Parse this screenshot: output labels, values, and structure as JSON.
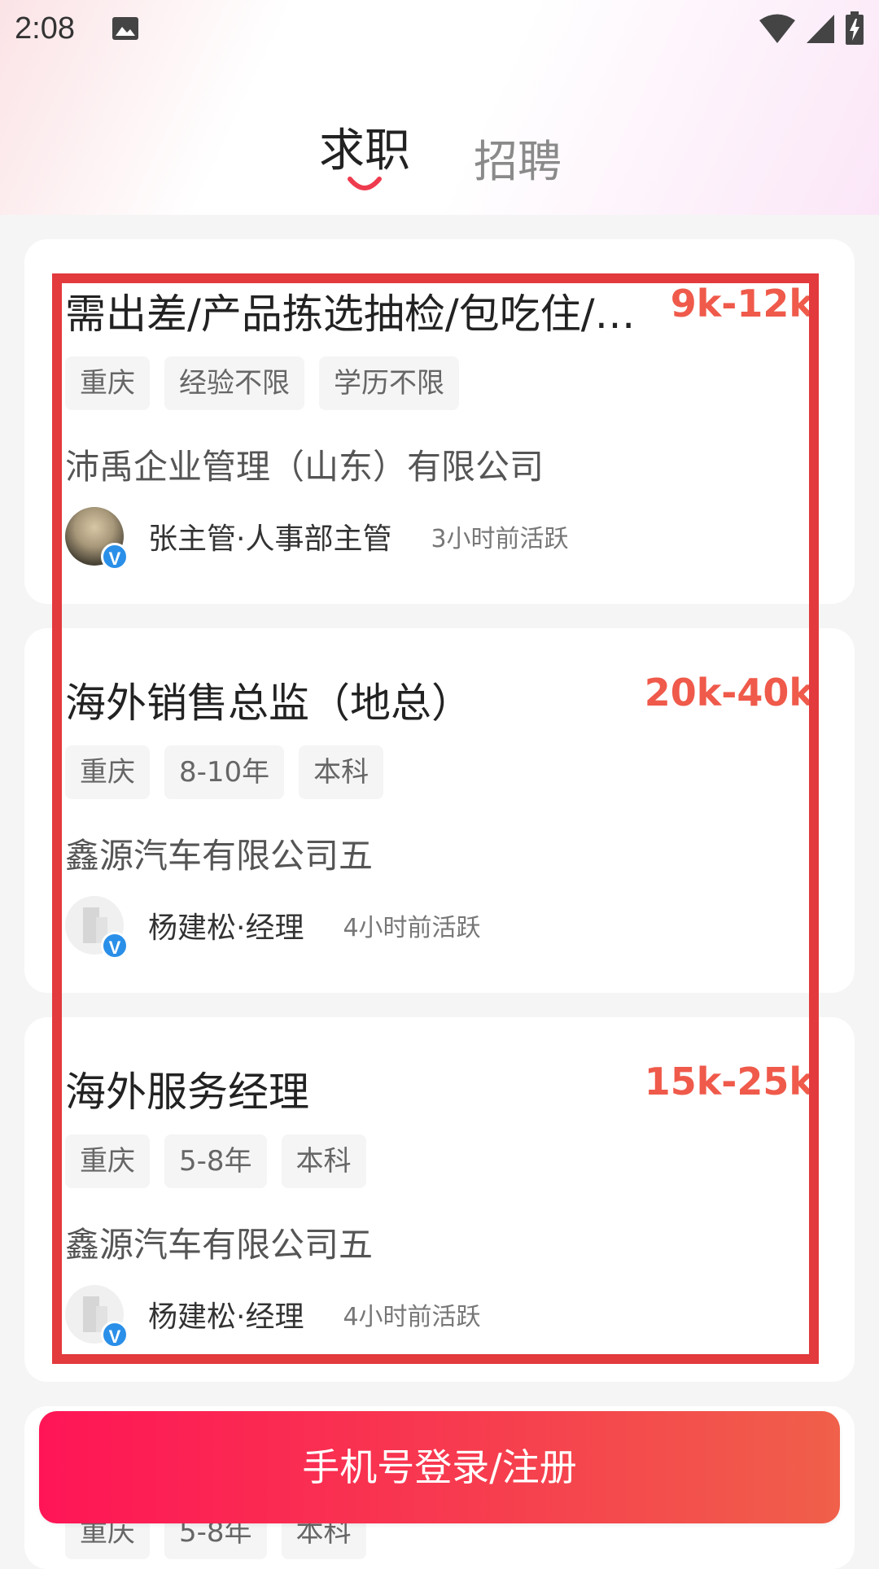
{
  "status_bar": {
    "time": "2:08",
    "icons": [
      "image-icon",
      "wifi-icon",
      "signal-icon",
      "battery-charging-icon"
    ]
  },
  "tabs": [
    {
      "label": "求职",
      "active": true
    },
    {
      "label": "招聘",
      "active": false
    }
  ],
  "jobs": [
    {
      "title": "需出差/产品拣选抽检/包吃住/…",
      "salary": "9k-12k",
      "tags": [
        "重庆",
        "经验不限",
        "学历不限"
      ],
      "company": "沛禹企业管理（山东）有限公司",
      "recruiter": "张主管·人事部主管",
      "active": "3小时前活跃",
      "avatar": "photo"
    },
    {
      "title": "海外销售总监（地总）",
      "salary": "20k-40k",
      "tags": [
        "重庆",
        "8-10年",
        "本科"
      ],
      "company": "鑫源汽车有限公司五",
      "recruiter": "杨建松·经理",
      "active": "4小时前活跃",
      "avatar": "logo"
    },
    {
      "title": "海外服务经理",
      "salary": "15k-25k",
      "tags": [
        "重庆",
        "5-8年",
        "本科"
      ],
      "company": "鑫源汽车有限公司五",
      "recruiter": "杨建松·经理",
      "active": "4小时前活跃",
      "avatar": "logo"
    },
    {
      "tags": [
        "重庆",
        "5-8年",
        "本科"
      ]
    }
  ],
  "verify_badge": "V",
  "login_button": "手机号登录/注册",
  "colors": {
    "salary": "#ef5a4b",
    "highlight": "#e23a3d",
    "login_start": "#ff1556",
    "login_end": "#f0604a"
  }
}
